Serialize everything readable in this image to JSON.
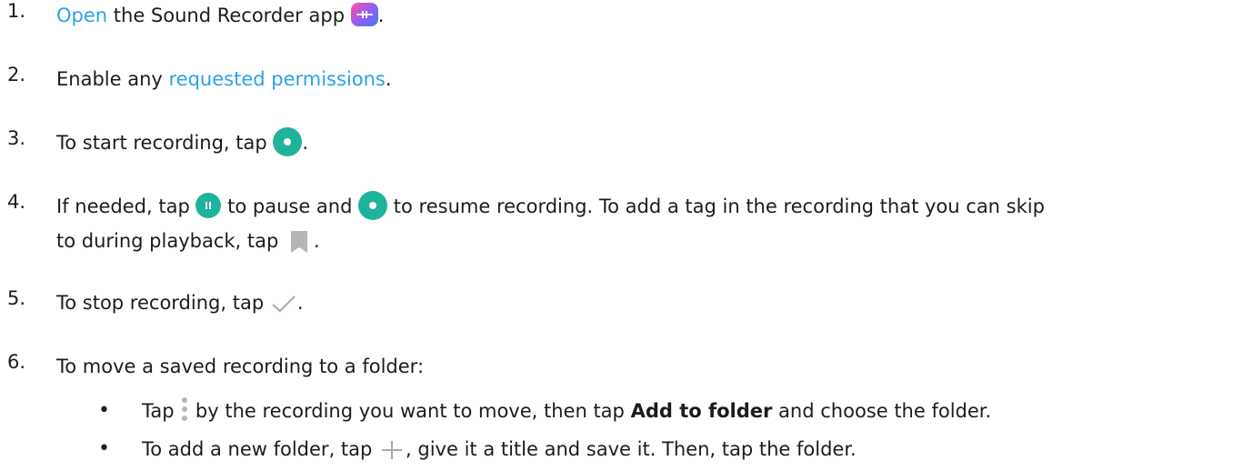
{
  "steps": [
    {
      "num": "1.",
      "parts": [
        "Open",
        " the Sound Recorder app ",
        "."
      ]
    },
    {
      "num": "2.",
      "parts": [
        "Enable any ",
        "requested permissions",
        "."
      ]
    },
    {
      "num": "3.",
      "parts": [
        "To start recording, tap ",
        "."
      ]
    },
    {
      "num": "4.",
      "parts": [
        "If needed, tap ",
        " to pause and ",
        " to resume recording. To add a tag in the recording that you can skip",
        "to during playback, tap ",
        "."
      ]
    },
    {
      "num": "5.",
      "parts": [
        "To stop recording, tap ",
        "."
      ]
    },
    {
      "num": "6.",
      "parts": [
        "To move a saved recording to a folder:"
      ]
    }
  ],
  "substeps": [
    {
      "bullet": "•",
      "parts": [
        "Tap ",
        " by the recording you want to move, then tap ",
        "Add to folder",
        " and choose the folder."
      ]
    },
    {
      "bullet": "•",
      "parts": [
        "To add a new folder, tap ",
        ", give it a title and save it. Then, tap the folder."
      ]
    }
  ],
  "colors": {
    "link": "#2ba3e6",
    "record_button": "#1fb39c",
    "icon_gray": "#b6b6b6"
  },
  "icons": [
    "sound-recorder-app-icon",
    "record-icon",
    "pause-icon",
    "bookmark-icon",
    "check-icon",
    "more-icon",
    "plus-icon"
  ]
}
